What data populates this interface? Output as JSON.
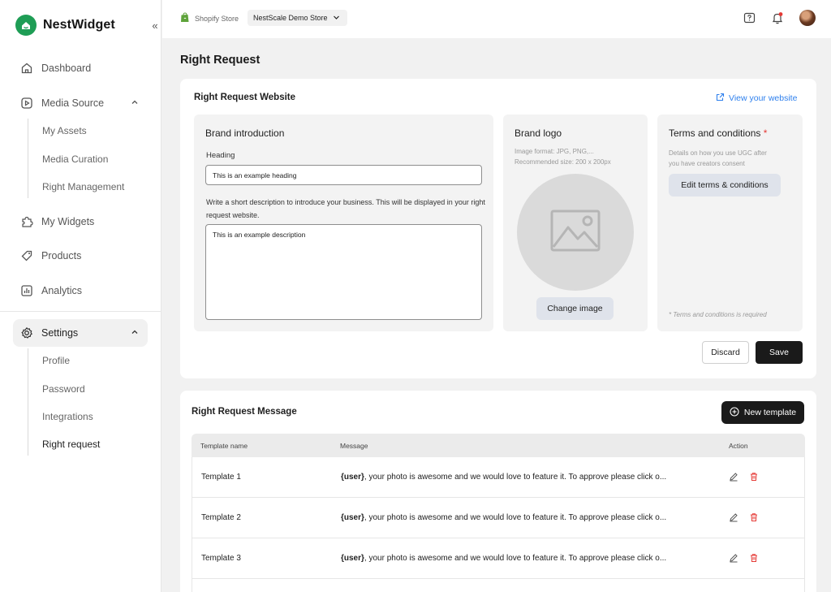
{
  "brand": {
    "name": "NestWidget"
  },
  "sidebar": {
    "items": [
      {
        "label": "Dashboard",
        "icon": "home-icon"
      },
      {
        "label": "Media Source",
        "icon": "play-square-icon"
      },
      {
        "label": "My Widgets",
        "icon": "puzzle-icon"
      },
      {
        "label": "Products",
        "icon": "tag-icon"
      },
      {
        "label": "Analytics",
        "icon": "bar-chart-icon"
      },
      {
        "label": "Settings",
        "icon": "gear-icon"
      }
    ],
    "media_sub": [
      "My Assets",
      "Media Curation",
      "Right Management"
    ],
    "settings_sub": [
      "Profile",
      "Password",
      "Integrations",
      "Right request"
    ]
  },
  "topbar": {
    "store_label": "Shopify Store",
    "store_value": "NestScale Demo Store"
  },
  "page": {
    "title": "Right Request"
  },
  "website_card": {
    "title": "Right Request Website",
    "link": "View your website",
    "brand_intro": {
      "title": "Brand introduction",
      "heading_label": "Heading",
      "heading_value": "This is an example heading",
      "desc_label": "Write a short description to introduce your business. This will be displayed in your right request website.",
      "desc_value": "This is an example description"
    },
    "brand_logo": {
      "title": "Brand logo",
      "hint_line1": "Image format: JPG, PNG,...",
      "hint_line2": "Recommended size: 200 x 200px",
      "button": "Change image"
    },
    "terms": {
      "title": "Terms and conditions",
      "star": "*",
      "hint_line1": "Details on how you use UGC after",
      "hint_line2": "you have creators consent",
      "button": "Edit terms & conditions",
      "note": "* Terms and conditions is required"
    },
    "discard": "Discard",
    "save": "Save"
  },
  "message_card": {
    "title": "Right Request Message",
    "new_template": "New template",
    "columns": [
      "Template name",
      "Message",
      "Action"
    ],
    "rows": [
      {
        "name": "Template 1",
        "user": "{user}",
        "message": ", your photo is awesome and we would love to feature it. To approve please click o..."
      },
      {
        "name": "Template 2",
        "user": "{user}",
        "message": ", your photo is awesome and we would love to feature it. To approve please click o..."
      },
      {
        "name": "Template 3",
        "user": "{user}",
        "message": ", your photo is awesome and we would love to feature it. To approve please click o..."
      }
    ]
  },
  "colors": {
    "brand_green": "#1e9d55",
    "link_blue": "#2f80ed",
    "danger": "#e53935",
    "dark": "#1a1a1a"
  }
}
